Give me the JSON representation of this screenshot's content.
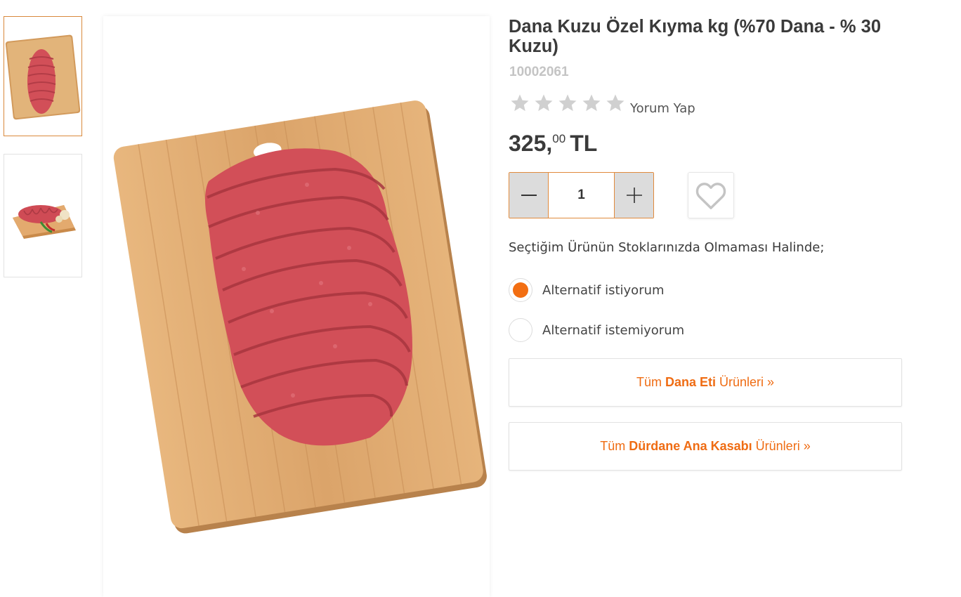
{
  "product": {
    "title": "Dana Kuzu Özel Kıyma kg (%70 Dana - % 30 Kuzu)",
    "sku": "10002061",
    "rating": {
      "stars": 5,
      "filled": 0,
      "review_label": "Yorum Yap"
    },
    "price": {
      "integer": "325,",
      "decimals": "00",
      "currency": "TL"
    }
  },
  "quantity": {
    "value": "1"
  },
  "gallery": {
    "thumbnail_count": 2,
    "active_index": 0
  },
  "stock_options": {
    "question": "Seçtiğim Ürünün Stoklarınızda Olmaması Halinde;",
    "options": [
      {
        "label": "Alternatif istiyorum",
        "selected": true
      },
      {
        "label": "Alternatif istemiyorum",
        "selected": false
      }
    ]
  },
  "category_links": [
    {
      "prefix": "Tüm",
      "highlight": "Dana Eti",
      "suffix": "Ürünleri »"
    },
    {
      "prefix": "Tüm",
      "highlight": "Dürdane Ana Kasabı",
      "suffix": "Ürünleri »"
    }
  ],
  "colors": {
    "accent": "#f26e12",
    "border_accent": "#e08a3c",
    "meat": "#d8505a",
    "board": "#dca66a"
  }
}
